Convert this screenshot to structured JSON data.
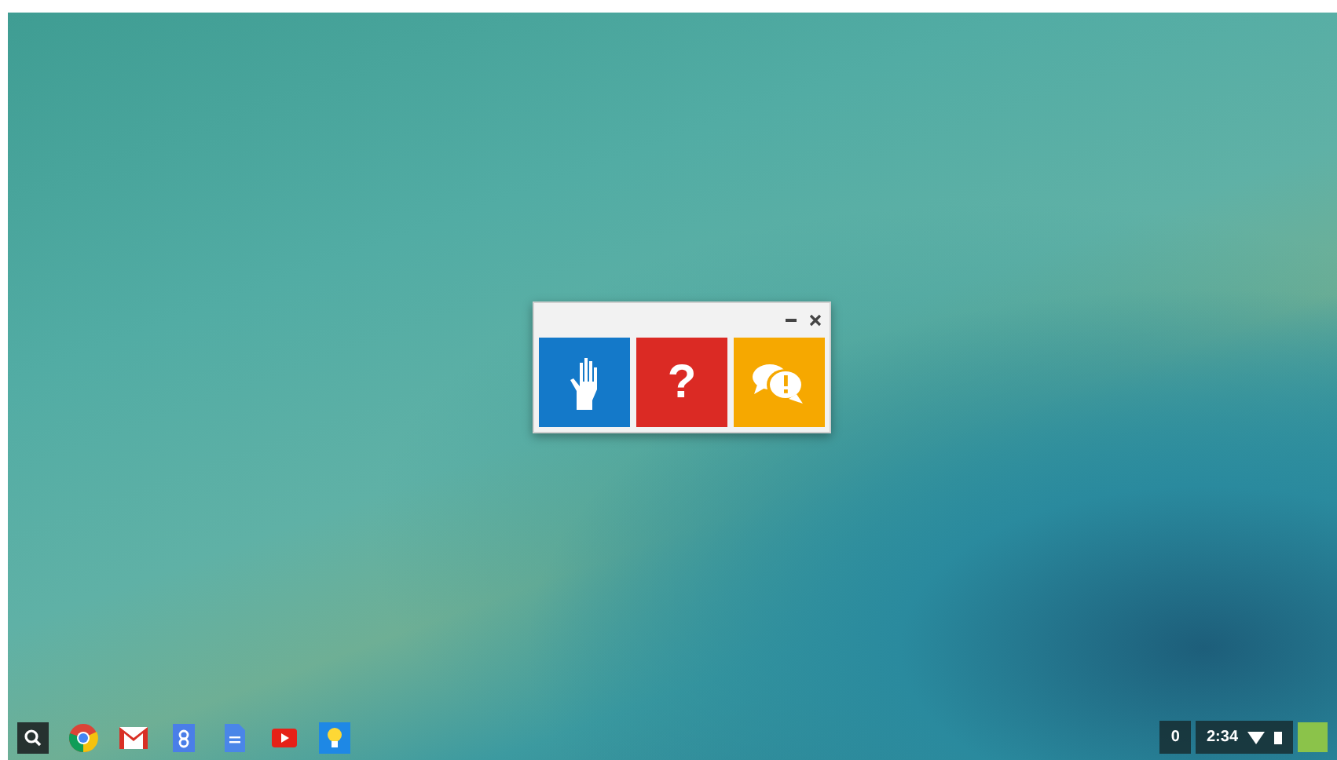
{
  "window": {
    "tiles": [
      {
        "kind": "hand",
        "color": "#1479c9"
      },
      {
        "kind": "question",
        "color": "#db2a24",
        "label": "?"
      },
      {
        "kind": "feedback",
        "color": "#f6a800"
      }
    ]
  },
  "shelf": {
    "apps": [
      {
        "kind": "search"
      },
      {
        "kind": "chrome"
      },
      {
        "kind": "mail"
      },
      {
        "kind": "gplus"
      },
      {
        "kind": "docs"
      },
      {
        "kind": "video"
      },
      {
        "kind": "bulb"
      }
    ]
  },
  "status_tray": {
    "notification_count": "0",
    "time": "2:34"
  }
}
